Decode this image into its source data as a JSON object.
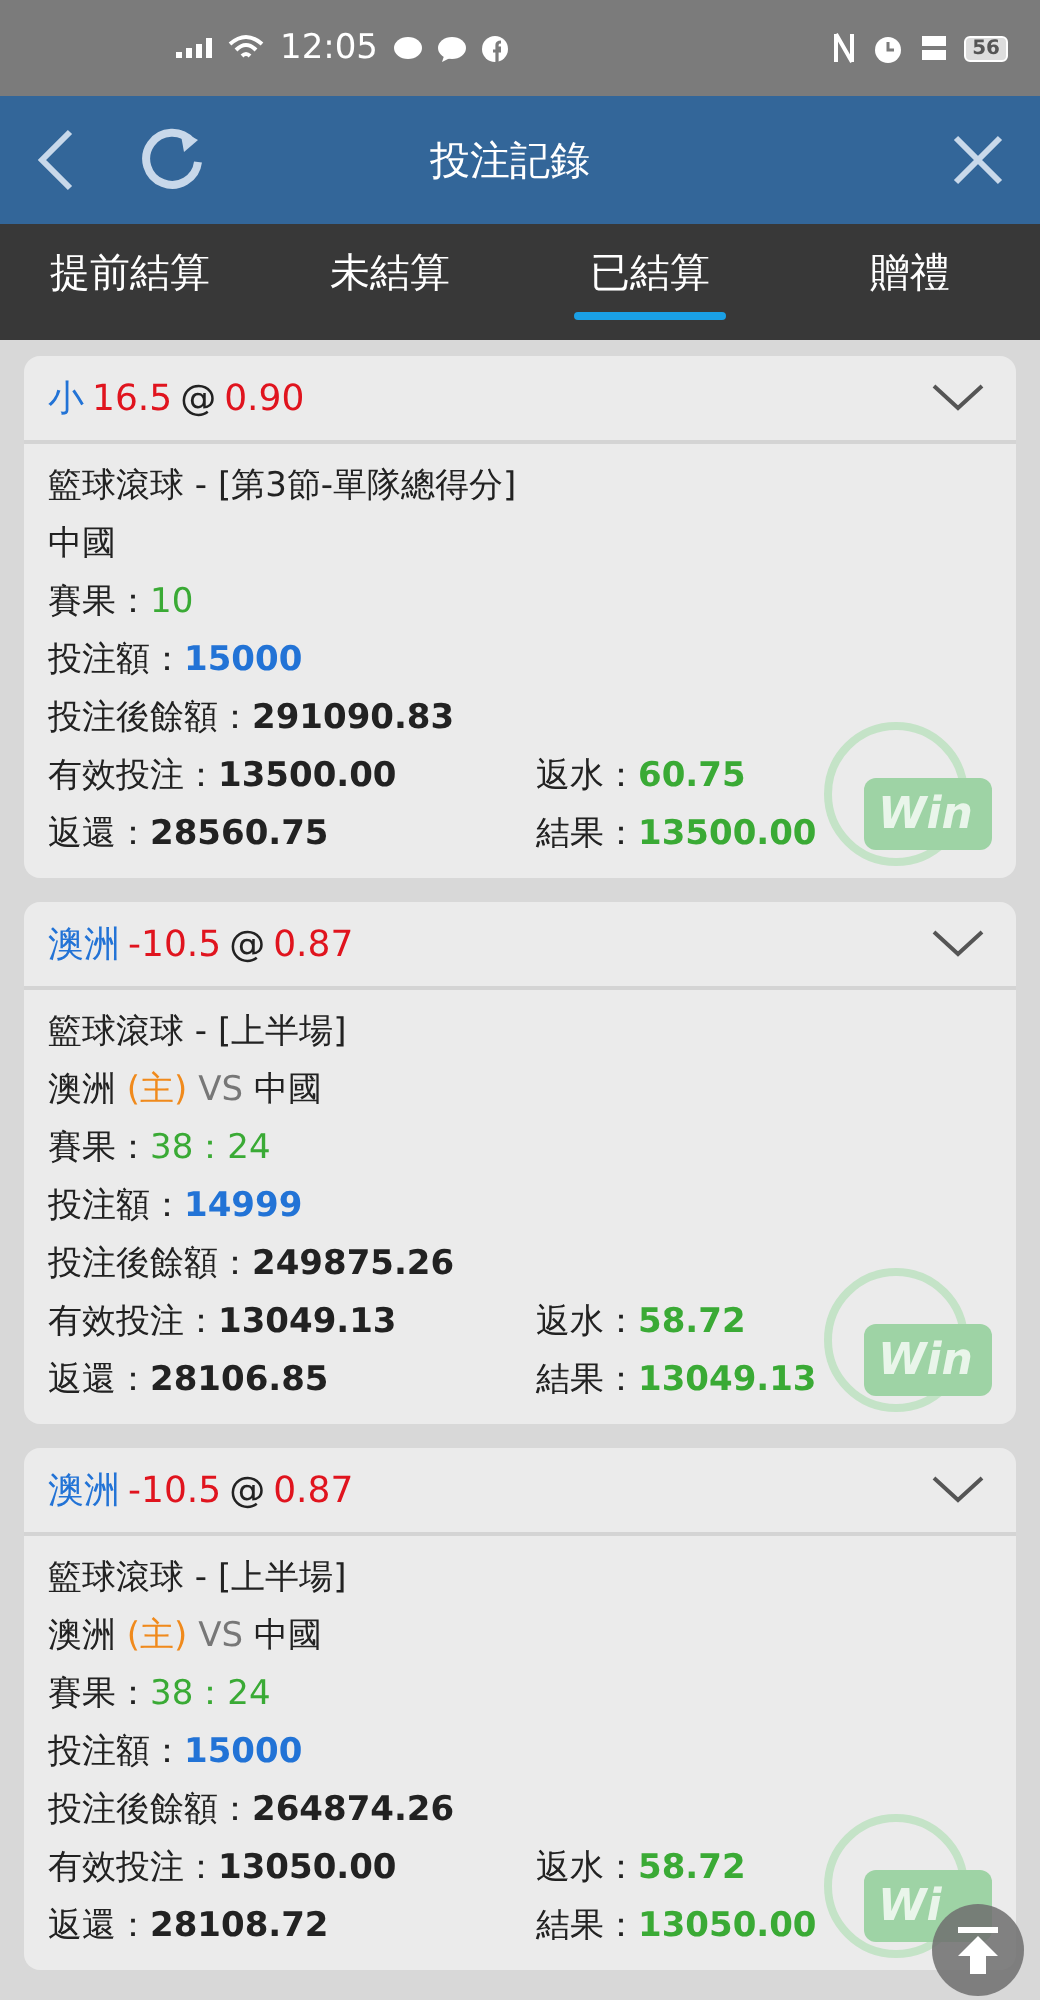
{
  "status_bar": {
    "time": "12:05",
    "battery": "56"
  },
  "header": {
    "title": "投注記錄"
  },
  "tabs": [
    {
      "label": "提前結算",
      "selected": false
    },
    {
      "label": "未結算",
      "selected": false
    },
    {
      "label": "已結算",
      "selected": true
    },
    {
      "label": "贈禮",
      "selected": false
    }
  ],
  "bets": [
    {
      "selection": "小",
      "line": "16.5",
      "at": "@",
      "odds": "0.90",
      "league": "籃球滾球 - [第3節-單隊總得分]",
      "match": {
        "kind": "team",
        "team": "中國"
      },
      "result_label": "賽果：",
      "result": "10",
      "stake_label": "投注額：",
      "stake": "15000",
      "balance_label": "投注後餘額：",
      "balance": "291090.83",
      "valid_label": "有效投注：",
      "valid": "13500.00",
      "rebate_label": "返水：",
      "rebate": "60.75",
      "return_label": "返還：",
      "return": "28560.75",
      "outcome_label": "結果：",
      "outcome": "13500.00",
      "stamp": "Win"
    },
    {
      "selection": "澳洲",
      "line": "-10.5",
      "at": "@",
      "odds": "0.87",
      "league": "籃球滾球 - [上半場]",
      "match": {
        "kind": "versus",
        "home": "澳洲",
        "home_tag": "(主)",
        "vs": "VS",
        "away": "中國"
      },
      "result_label": "賽果：",
      "result": "38：24",
      "stake_label": "投注額：",
      "stake": "14999",
      "balance_label": "投注後餘額：",
      "balance": "249875.26",
      "valid_label": "有效投注：",
      "valid": "13049.13",
      "rebate_label": "返水：",
      "rebate": "58.72",
      "return_label": "返還：",
      "return": "28106.85",
      "outcome_label": "結果：",
      "outcome": "13049.13",
      "stamp": "Win"
    },
    {
      "selection": "澳洲",
      "line": "-10.5",
      "at": "@",
      "odds": "0.87",
      "league": "籃球滾球 - [上半場]",
      "match": {
        "kind": "versus",
        "home": "澳洲",
        "home_tag": "(主)",
        "vs": "VS",
        "away": "中國"
      },
      "result_label": "賽果：",
      "result": "38：24",
      "stake_label": "投注額：",
      "stake": "15000",
      "balance_label": "投注後餘額：",
      "balance": "264874.26",
      "valid_label": "有效投注：",
      "valid": "13050.00",
      "rebate_label": "返水：",
      "rebate": "58.72",
      "return_label": "返還：",
      "return": "28108.72",
      "outcome_label": "結果：",
      "outcome": "13050.00",
      "stamp": "Wi"
    }
  ]
}
